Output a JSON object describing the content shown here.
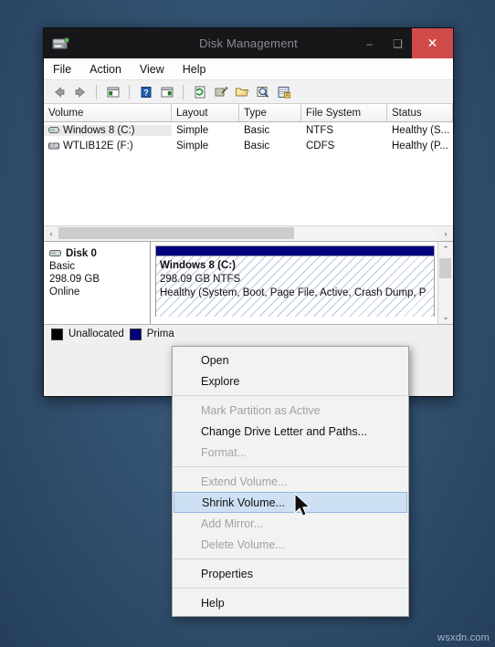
{
  "desktop": {
    "watermark": "wsxdn.com"
  },
  "window": {
    "title": "Disk Management",
    "icon": "disk-drive-icon",
    "controls": {
      "minimize": "–",
      "maximize": "❑",
      "close": "✕"
    },
    "menubar": [
      "File",
      "Action",
      "View",
      "Help"
    ],
    "toolbar_icons": [
      "back-arrow-icon",
      "forward-arrow-icon",
      "show-hide-console-tree-icon",
      "help-icon",
      "show-hide-action-pane-icon",
      "refresh-icon",
      "rescan-disks-icon",
      "open-folder-icon",
      "properties-search-icon",
      "disk-properties-icon"
    ]
  },
  "volume_list": {
    "columns": [
      "Volume",
      "Layout",
      "Type",
      "File System",
      "Status"
    ],
    "rows": [
      {
        "icon": "hard-disk-volume-icon",
        "volume": "Windows 8 (C:)",
        "layout": "Simple",
        "type": "Basic",
        "file_system": "NTFS",
        "status": "Healthy (S...",
        "selected": true
      },
      {
        "icon": "cd-rom-volume-icon",
        "volume": "WTLIB12E (F:)",
        "layout": "Simple",
        "type": "Basic",
        "file_system": "CDFS",
        "status": "Healthy (P...",
        "selected": false
      }
    ],
    "hscroll": {
      "left_arrow": "‹",
      "right_arrow": "›"
    }
  },
  "disk_pane": {
    "disk": {
      "icon": "disk-icon",
      "name": "Disk 0",
      "type": "Basic",
      "capacity": "298.09 GB",
      "state": "Online"
    },
    "partition": {
      "label": "Windows 8  (C:)",
      "size": "298.09 GB NTFS",
      "status": "Healthy (System, Boot, Page File, Active, Crash Dump, P",
      "header_color": "#00007c"
    },
    "vscroll": {
      "up_arrow": "⌃",
      "down_arrow": "⌄"
    }
  },
  "legend": {
    "items": [
      {
        "label": "Unallocated",
        "color": "#000000"
      },
      {
        "label": "Prima",
        "color": "#00007c"
      }
    ]
  },
  "context_menu": {
    "items": [
      {
        "label": "Open",
        "state": "enabled"
      },
      {
        "label": "Explore",
        "state": "enabled"
      },
      {
        "separator": true
      },
      {
        "label": "Mark Partition as Active",
        "state": "disabled"
      },
      {
        "label": "Change Drive Letter and Paths...",
        "state": "enabled"
      },
      {
        "label": "Format...",
        "state": "disabled"
      },
      {
        "separator": true
      },
      {
        "label": "Extend Volume...",
        "state": "disabled"
      },
      {
        "label": "Shrink Volume...",
        "state": "highlighted"
      },
      {
        "label": "Add Mirror...",
        "state": "disabled"
      },
      {
        "label": "Delete Volume...",
        "state": "disabled"
      },
      {
        "separator": true
      },
      {
        "label": "Properties",
        "state": "enabled"
      },
      {
        "separator": true
      },
      {
        "label": "Help",
        "state": "enabled"
      }
    ],
    "highlight_color": "#cde0f4"
  }
}
